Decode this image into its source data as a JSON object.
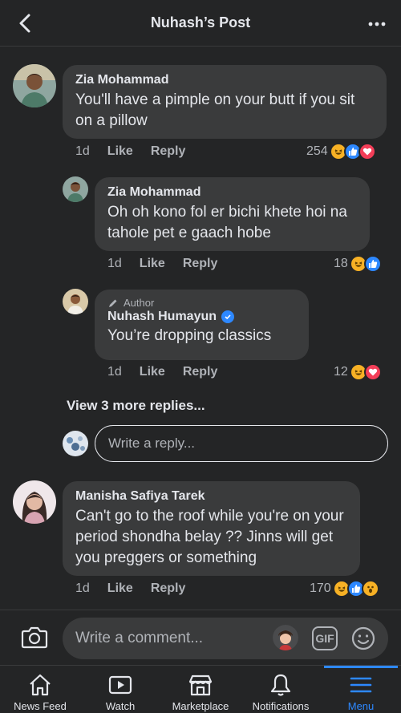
{
  "header": {
    "title": "Nuhash’s Post"
  },
  "comments": [
    {
      "name": "Zia Mohammad",
      "text": "You'll have a pimple on your butt if you sit on a pillow",
      "time": "1d",
      "like": "Like",
      "reply": "Reply",
      "count": "254",
      "reactions": [
        "haha",
        "like",
        "love"
      ]
    },
    {
      "name": "Zia Mohammad",
      "text": "Oh oh kono fol er bichi khete hoi na tahole pet e gaach hobe",
      "time": "1d",
      "like": "Like",
      "reply": "Reply",
      "count": "18",
      "reactions": [
        "haha",
        "like"
      ]
    },
    {
      "author_tag": "Author",
      "name": "Nuhash Humayun",
      "text": "You’re dropping classics",
      "time": "1d",
      "like": "Like",
      "reply": "Reply",
      "count": "12",
      "reactions": [
        "haha",
        "love"
      ]
    },
    {
      "name": "Manisha Safiya Tarek",
      "text": "Can't go to the roof while you're on your period shondha belay ?? Jinns will get you preggers or something",
      "time": "1d",
      "like": "Like",
      "reply": "Reply",
      "count": "170",
      "reactions": [
        "haha",
        "like",
        "wow"
      ]
    }
  ],
  "view_more_replies": "View 3 more replies...",
  "reply_box": {
    "placeholder": "Write a reply..."
  },
  "composer": {
    "placeholder": "Write a comment...",
    "gif_label": "GIF"
  },
  "tabs": [
    {
      "label": "News Feed",
      "icon": "home-icon"
    },
    {
      "label": "Watch",
      "icon": "watch-icon"
    },
    {
      "label": "Marketplace",
      "icon": "marketplace-icon"
    },
    {
      "label": "Notifications",
      "icon": "bell-icon"
    },
    {
      "label": "Menu",
      "icon": "menu-icon",
      "active": true
    }
  ],
  "colors": {
    "accent": "#2d88ff",
    "background": "#242526",
    "bubble": "#3a3b3c",
    "haha": "#f7b125",
    "love": "#f33e58"
  }
}
